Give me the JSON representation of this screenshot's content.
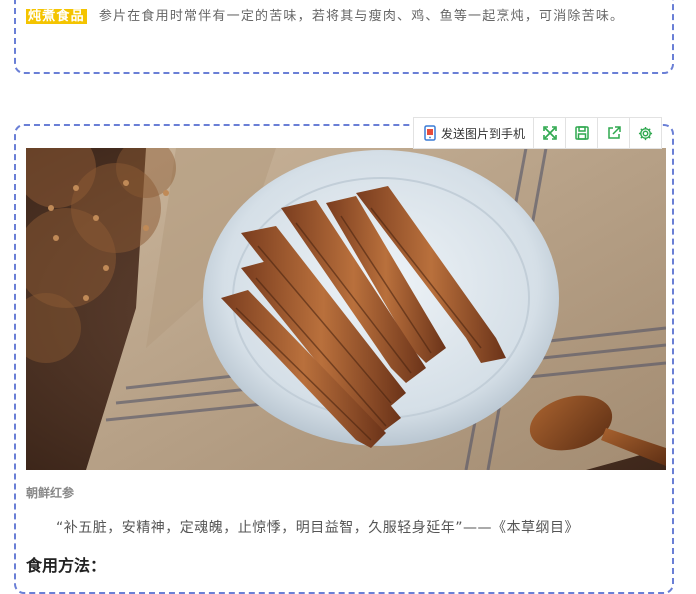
{
  "intro": {
    "tag": "炖煮食品",
    "text": "参片在食用时常伴有一定的苦味，若将其与瘦肉、鸡、鱼等一起烹炖，可消除苦味。"
  },
  "toolbar": {
    "send_label": "发送图片到手机",
    "icons": [
      "phone-icon",
      "expand-icon",
      "save-icon",
      "share-icon",
      "gear-icon"
    ],
    "accent": "#2fa84f"
  },
  "image": {
    "caption": "朝鲜红参"
  },
  "quote": "“补五脏，安精神，定魂魄，止惊悸，明目益智，久服轻身延年”——《本草纲目》",
  "section_heading": "食用方法："
}
